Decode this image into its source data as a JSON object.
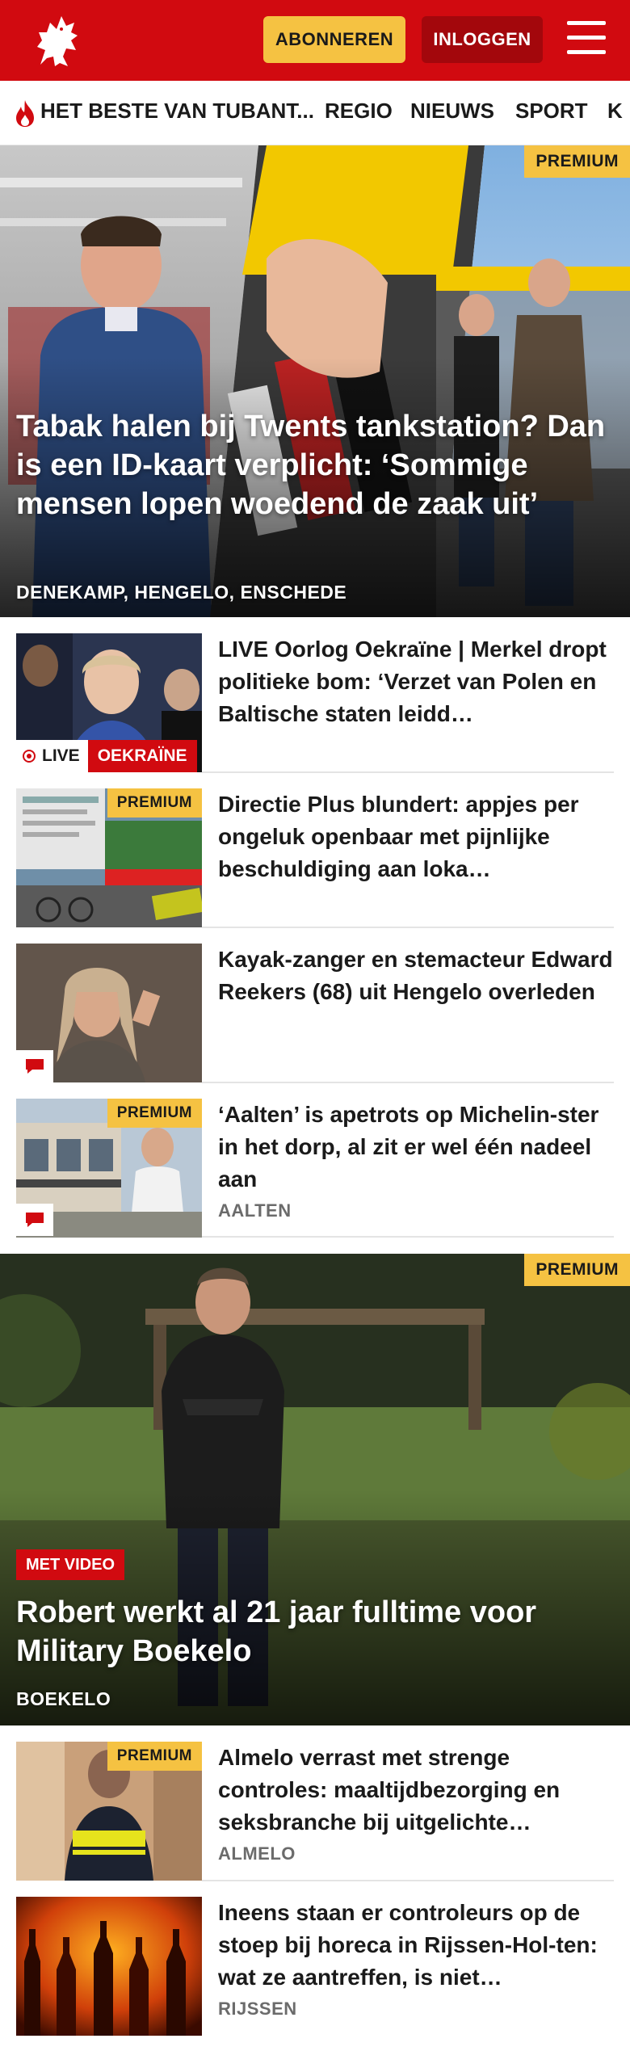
{
  "header": {
    "subscribe_label": "ABONNEREN",
    "login_label": "INLOGGEN",
    "logo_icon": "horse-logo-icon",
    "menu_icon": "hamburger-menu-icon",
    "brand_color": "#d10a10",
    "accent_color": "#f5c242"
  },
  "nav": {
    "items": [
      {
        "label": "HET BESTE VAN TUBANT...",
        "icon": "flame-icon"
      },
      {
        "label": "REGIO"
      },
      {
        "label": "NIEUWS"
      },
      {
        "label": "SPORT"
      },
      {
        "label": "K"
      }
    ]
  },
  "hero1": {
    "badge": "PREMIUM",
    "title": "Tabak halen bij Twents tankstation? Dan is een ID-kaart verplicht: ‘Sommige mensen lopen woedend de zaak uit’",
    "location": "DENEKAMP, HENGELO, ENSCHEDE"
  },
  "articles1": [
    {
      "title": "LIVE Oorlog Oekraïne | Merkel dropt politieke bom: ‘Verzet van Polen en Baltische staten leidd…",
      "live_label": "LIVE",
      "tag": "OEKRAÏNE"
    },
    {
      "title": "Directie Plus blundert: appjes per ongeluk openbaar met pijnlijke beschuldiging aan loka…",
      "badge": "PREMIUM"
    },
    {
      "title": "Kayak-zanger en stemacteur Edward Reekers (68) uit Hengelo overleden",
      "comment_icon": "comment-icon"
    },
    {
      "title": "‘Aalten’ is apetrots op Michelin-ster in het dorp, al zit er wel één nadeel aan",
      "badge": "PREMIUM",
      "location": "AALTEN",
      "comment_icon": "comment-icon"
    }
  ],
  "hero2": {
    "badge": "PREMIUM",
    "video_badge": "MET VIDEO",
    "title": "Robert werkt al 21 jaar fulltime voor Military Boekelo",
    "location": "BOEKELO"
  },
  "articles2": [
    {
      "title": "Almelo verrast met strenge controles: maaltijdbezorging en seksbranche bij uitgelichte…",
      "badge": "PREMIUM",
      "location": "ALMELO"
    },
    {
      "title": "Ineens staan er controleurs op de stoep bij horeca in Rijssen-Hol-ten: wat ze aantreffen, is niet…",
      "location": "RIJSSEN"
    }
  ]
}
